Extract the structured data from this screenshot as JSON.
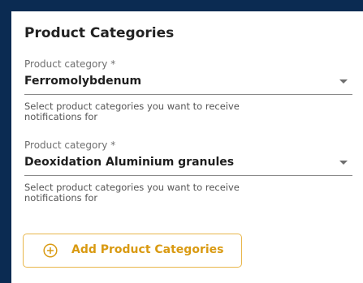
{
  "card": {
    "title": "Product Categories"
  },
  "fields": [
    {
      "label": "Product category *",
      "value": "Ferromolybdenum",
      "helper": "Select product categories you want to receive notifications for"
    },
    {
      "label": "Product category *",
      "value": "Deoxidation Aluminium granules",
      "helper": "Select product categories you want to receive notifications for"
    }
  ],
  "actions": {
    "add_label": "Add Product Categories"
  },
  "colors": {
    "background": "#0b2b52",
    "accent": "#e8b64a",
    "accent_text": "#d99a12"
  },
  "icons": {
    "add": "plus-circle-icon",
    "dropdown": "chevron-down-icon"
  }
}
